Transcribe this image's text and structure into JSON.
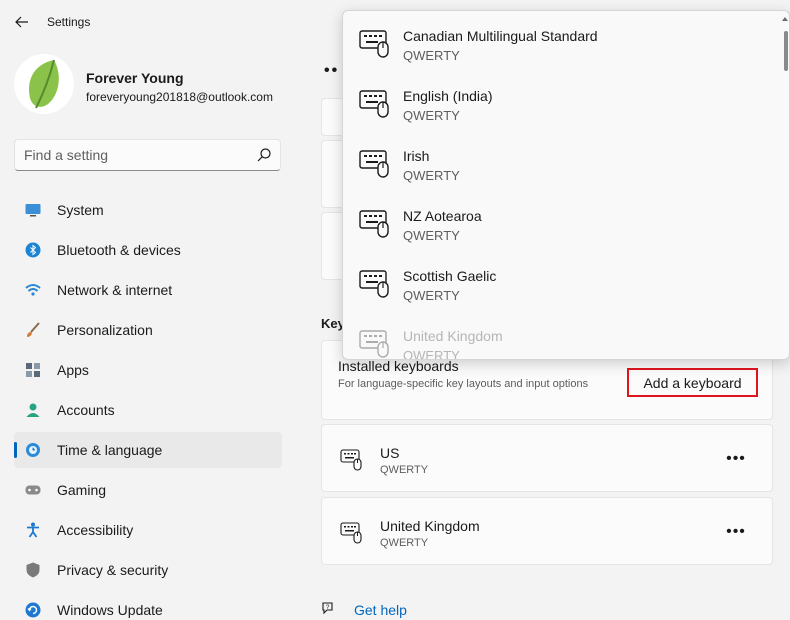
{
  "window": {
    "title": "Settings"
  },
  "profile": {
    "name": "Forever Young",
    "email": "foreveryoung201818@outlook.com"
  },
  "search": {
    "placeholder": "Find a setting"
  },
  "nav": [
    {
      "label": "System",
      "icon": "monitor-icon",
      "color": "#3b8fd6"
    },
    {
      "label": "Bluetooth & devices",
      "icon": "bluetooth-icon",
      "color": "#1c84d4"
    },
    {
      "label": "Network & internet",
      "icon": "wifi-icon",
      "color": "#2a86d6"
    },
    {
      "label": "Personalization",
      "icon": "brush-icon",
      "color": "#d17b3a"
    },
    {
      "label": "Apps",
      "icon": "apps-icon",
      "color": "#5a6a7a"
    },
    {
      "label": "Accounts",
      "icon": "person-icon",
      "color": "#27a382"
    },
    {
      "label": "Time & language",
      "icon": "globe-clock-icon",
      "color": "#2c8bd8",
      "selected": true
    },
    {
      "label": "Gaming",
      "icon": "gamepad-icon",
      "color": "#8a8a8a"
    },
    {
      "label": "Accessibility",
      "icon": "accessibility-icon",
      "color": "#1e78d0"
    },
    {
      "label": "Privacy & security",
      "icon": "shield-icon",
      "color": "#7a7a7a"
    },
    {
      "label": "Windows Update",
      "icon": "update-icon",
      "color": "#1e78d0"
    }
  ],
  "main": {
    "section_fragment": "Key",
    "installed": {
      "title": "Installed keyboards",
      "description": "For language-specific key layouts and input options",
      "add_button": "Add a keyboard"
    },
    "keyboards": [
      {
        "name": "US",
        "layout": "QWERTY"
      },
      {
        "name": "United Kingdom",
        "layout": "QWERTY"
      }
    ],
    "get_help": "Get help"
  },
  "dropdown": {
    "items": [
      {
        "name": "Canadian Multilingual Standard",
        "layout": "QWERTY"
      },
      {
        "name": "English (India)",
        "layout": "QWERTY"
      },
      {
        "name": "Irish",
        "layout": "QWERTY"
      },
      {
        "name": "NZ Aotearoa",
        "layout": "QWERTY"
      },
      {
        "name": "Scottish Gaelic",
        "layout": "QWERTY"
      },
      {
        "name": "United Kingdom",
        "layout": "QWERTY",
        "faded": true
      }
    ]
  },
  "colors": {
    "accent": "#0067c0",
    "highlight_border": "#e0141e"
  }
}
